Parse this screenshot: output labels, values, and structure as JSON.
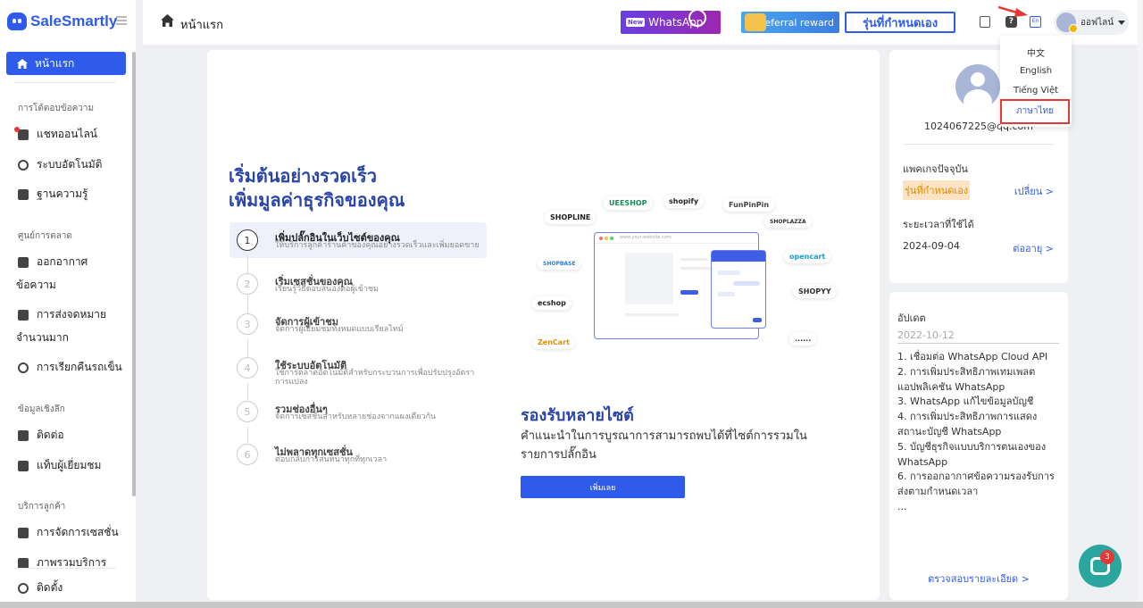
{
  "app": {
    "logo_text": "SaleSmartly"
  },
  "sidebar": {
    "home": "หน้าแรก",
    "groups": [
      {
        "title": "การโต้ตอบข้อความ",
        "items": [
          "แชทออนไลน์",
          "ระบบอัตโนมัติ",
          "ฐานความรู้"
        ]
      },
      {
        "title": "ศูนย์การตลาด",
        "items": [
          "ออกอากาศ",
          "ข้อความ",
          "การส่งจดหมาย",
          "จำนวนมาก",
          "การเรียกคืนรถเข็น"
        ]
      },
      {
        "title": "ข้อมูลเชิงลึก",
        "items": [
          "ติดต่อ",
          "แท็บผู้เยี่ยมชม"
        ]
      },
      {
        "title": "บริการลูกค้า",
        "items": [
          "การจัดการเซสชั่น",
          "ภาพรวมบริการ"
        ]
      }
    ],
    "settings": "ติดตั้ง"
  },
  "header": {
    "title": "หน้าแรก",
    "whatsapp_new": "New",
    "whatsapp_label": "WhatsApp",
    "referral_label": "referral reward",
    "custom_button": "รุ่นที่กำหนดเอง",
    "help_icon_text": "?",
    "lang_icon_text": "En",
    "user_name": "ออฟไลน์"
  },
  "lang_menu": [
    "中文",
    "English",
    "Tiếng Việt",
    "ภาษาไทย"
  ],
  "main": {
    "hero_title": "เริ่มต้นอย่างรวดเร็ว\nเพิ่มมูลค่าธุรกิจของคุณ",
    "steps": [
      {
        "num": "1",
        "title": "เพิ่มปลั๊กอินในเว็บไซต์ของคุณ",
        "desc": "ให้บริการลูกค้าร้านค้าของคุณอย่างรวดเร็วและเพิ่มยอดขาย"
      },
      {
        "num": "2",
        "title": "เริ่มเซสชั่นของคุณ",
        "desc": "เรียนรู้วิธีตอบสนองต่อผู้เข้าชม"
      },
      {
        "num": "3",
        "title": "จัดการผู้เข้าชม",
        "desc": "จัดการผู้เยี่ยมชมทั้งหมดแบบเรียลไทม์"
      },
      {
        "num": "4",
        "title": "ใช้ระบบอัตโนมัติ",
        "desc": "ใช้การตลาดอัตโนมัติสำหรับกระบวนการเพื่อปรับปรุงอัตราการแปลง"
      },
      {
        "num": "5",
        "title": "รวมช่องอื่นๆ",
        "desc": "จัดการเซสชั่นสำหรับหลายช่องจากแผงเดียวกัน"
      },
      {
        "num": "6",
        "title": "ไม่พลาดทุกเซสชั่น",
        "desc": "ตอบกลับการสนทนาทุกที่ทุกเวลา"
      }
    ],
    "brands": [
      "SHOPLINE",
      "UEESHOP",
      "shopify",
      "FunPinPin",
      "SHOPLAZZA",
      "opencart",
      "SHOPYY",
      "ecshop",
      "ZenCart",
      "......",
      "SHOPBASE"
    ],
    "browser_url": "www.your-website.com",
    "multi_title": "รองรับหลายไซต์",
    "multi_desc": "คำแนะนำในการบูรณาการสามารถพบได้ที่ไซต์การรวมในรายการปลั๊กอิน",
    "add_button": "เพิ่มเลย"
  },
  "profile": {
    "email": "1024067225@qq.com",
    "plan_label": "แพคเกจปัจจุบัน",
    "plan_value": "รุ่นที่กำหนดเอง",
    "plan_link": "เปลี่ยน >",
    "expiry_label": "ระยะเวลาที่ใช้ได้",
    "expiry_value": "2024-09-04",
    "renew_link": "ต่ออายุ >"
  },
  "updates": {
    "title": "อัปเดต",
    "date": "2022-10-12",
    "items": [
      "1. เชื่อมต่อ WhatsApp Cloud API",
      "2. การเพิ่มประสิทธิภาพเทมเพลตแอปพลิเคชัน WhatsApp",
      "3. WhatsApp แก้ไขข้อมูลบัญชี",
      "4. การเพิ่มประสิทธิภาพการแสดงสถานะบัญชี WhatsApp",
      "5. บัญชีธุรกิจแบบบริการตนเองของ WhatsApp",
      "6. การออกอากาศข้อความรองรับการส่งตามกำหนดเวลา",
      "..."
    ],
    "more_link": "ตรวจสอบรายละเอียด >"
  },
  "chat_widget": {
    "badge": "3"
  },
  "colors": {
    "accent": "#2f5bea",
    "heading": "#2b44a8",
    "highlight": "#e53935"
  }
}
